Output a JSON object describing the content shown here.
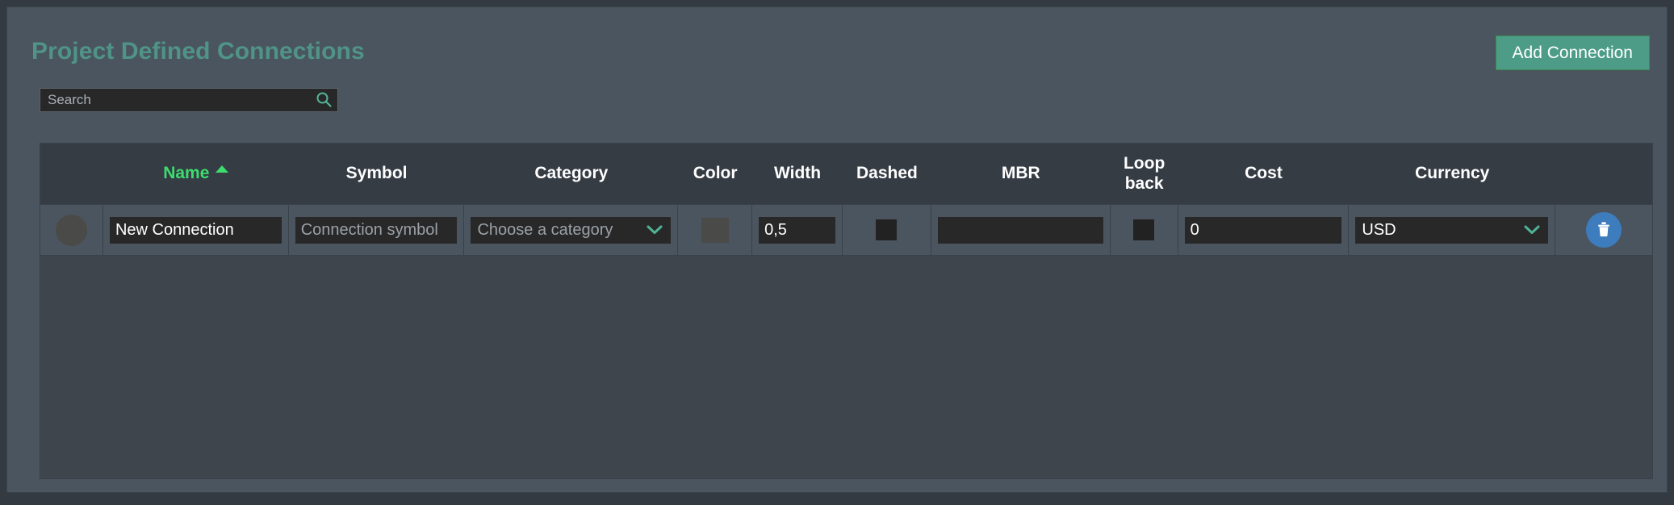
{
  "header": {
    "title": "Project Defined Connections",
    "add_button_label": "Add Connection",
    "search": {
      "placeholder": "Search",
      "value": "",
      "icon": "search-icon"
    }
  },
  "table": {
    "sort": {
      "column": "Name",
      "direction": "asc"
    },
    "columns": [
      {
        "key": "avatar",
        "label": ""
      },
      {
        "key": "name",
        "label": "Name"
      },
      {
        "key": "symbol",
        "label": "Symbol"
      },
      {
        "key": "category",
        "label": "Category"
      },
      {
        "key": "color",
        "label": "Color"
      },
      {
        "key": "width",
        "label": "Width"
      },
      {
        "key": "dashed",
        "label": "Dashed"
      },
      {
        "key": "mbr",
        "label": "MBR"
      },
      {
        "key": "loopback",
        "label": "Loop\nback"
      },
      {
        "key": "cost",
        "label": "Cost"
      },
      {
        "key": "currency",
        "label": "Currency"
      },
      {
        "key": "actions",
        "label": ""
      }
    ],
    "rows": [
      {
        "name_value": "New Connection",
        "symbol_placeholder": "Connection symbol",
        "symbol_value": "",
        "category_selected": "Choose a category",
        "color_value": "#4a4a48",
        "width_value": "0,5",
        "dashed_checked": false,
        "mbr_value": "",
        "loopback_checked": false,
        "cost_value": "0",
        "currency_selected": "USD",
        "delete_icon": "trash-icon"
      }
    ]
  },
  "colors": {
    "page_background": "#333a42",
    "panel_background": "#4b555f",
    "table_background": "#3e454d",
    "table_header_background": "#353c44",
    "title_teal": "#4f9486",
    "accent_green": "#3ddc6f",
    "add_button_green": "#4c9c88",
    "delete_blue": "#3d7dbd",
    "input_dark": "#282828"
  }
}
